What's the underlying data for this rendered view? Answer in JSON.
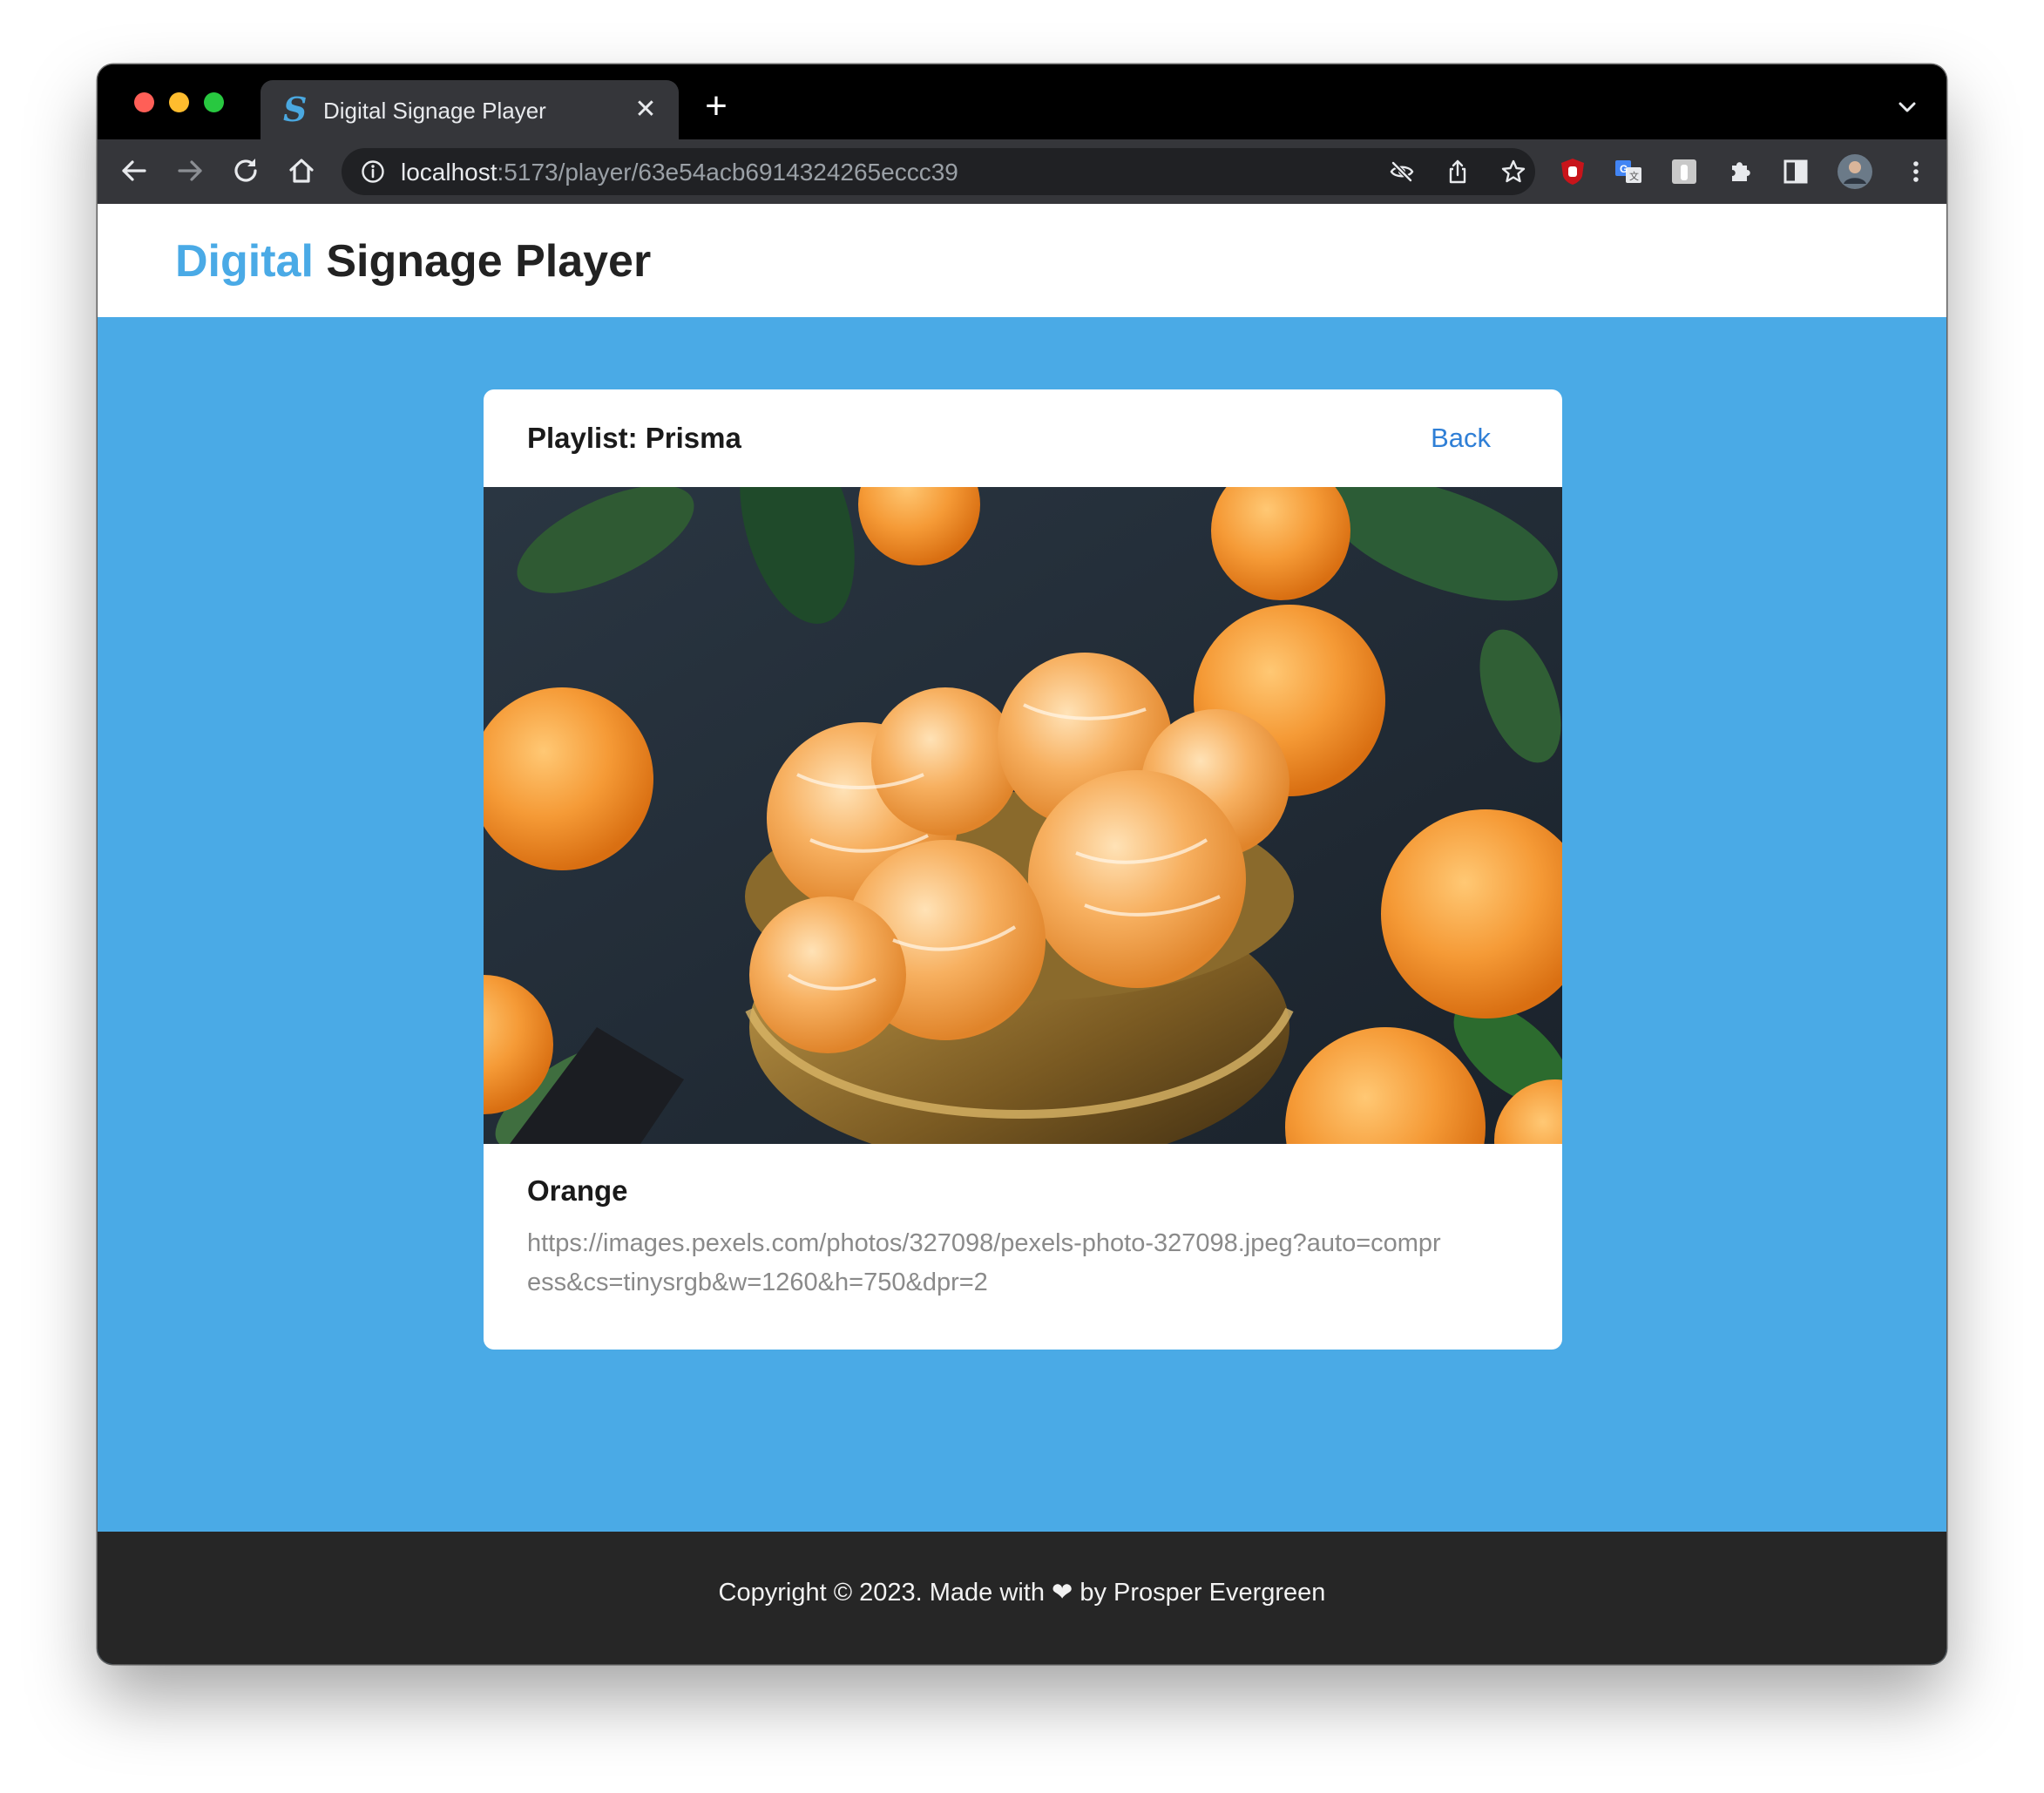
{
  "browser": {
    "tab": {
      "favicon_glyph": "S",
      "title": "Digital Signage Player",
      "close_glyph": "✕"
    },
    "new_tab_glyph": "+",
    "url": {
      "host": "localhost",
      "path": ":5173/player/63e54acb6914324265eccc39"
    },
    "icons": [
      "back-icon",
      "forward-icon",
      "reload-icon",
      "home-icon",
      "site-info-icon",
      "eye-off-icon",
      "share-icon",
      "star-icon",
      "ublock-extension-icon",
      "translate-extension-icon",
      "gray-extension-icon",
      "puzzle-icon",
      "side-panel-icon",
      "profile-avatar",
      "kebab-menu-icon",
      "chevron-down-icon"
    ]
  },
  "header": {
    "brand_accent": "Digital",
    "brand_rest": " Signage Player"
  },
  "card": {
    "playlist_title": "Playlist: Prisma",
    "back_label": "Back",
    "item_title": "Orange",
    "item_url": "https://images.pexels.com/photos/327098/pexels-photo-327098.jpeg?auto=compress&cs=tinysrgb&w=1260&h=750&dpr=2"
  },
  "footer": {
    "text": "Copyright © 2023. Made with ❤ by Prosper Evergreen"
  },
  "colors": {
    "accent": "#4aaae6",
    "link": "#2f7fd6",
    "footer_bg": "#262626"
  }
}
